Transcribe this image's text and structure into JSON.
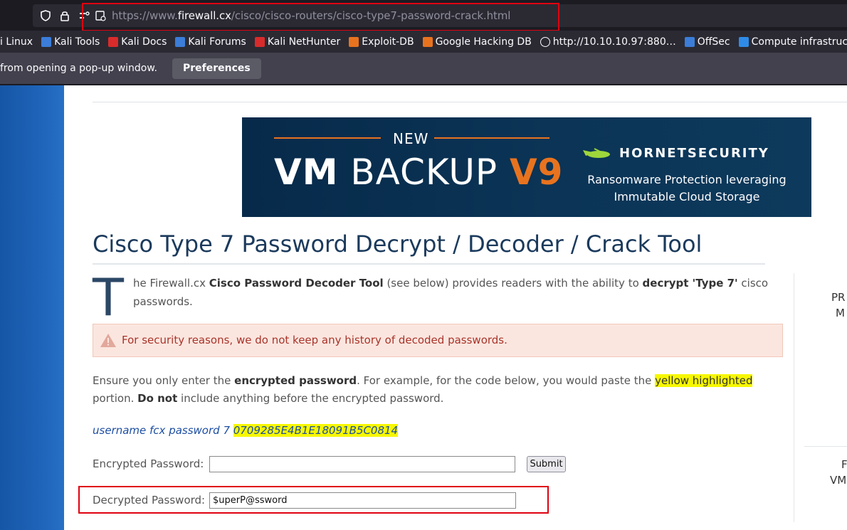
{
  "browser": {
    "url_prefix": "https://www.",
    "url_domain": "firewall.cx",
    "url_path": "/cisco/cisco-routers/cisco-type7-password-crack.html",
    "bookmarks": [
      {
        "label": "i Linux",
        "icon": "kali-icon",
        "color": "#2b2a33"
      },
      {
        "label": "Kali Tools",
        "icon": "kali-tools-icon",
        "color": "#3b7dd8"
      },
      {
        "label": "Kali Docs",
        "icon": "kali-docs-icon",
        "color": "#d92b2b"
      },
      {
        "label": "Kali Forums",
        "icon": "kali-forums-icon",
        "color": "#3b7dd8"
      },
      {
        "label": "Kali NetHunter",
        "icon": "nethunter-icon",
        "color": "#d92b2b"
      },
      {
        "label": "Exploit-DB",
        "icon": "exploit-db-icon",
        "color": "#e8731f"
      },
      {
        "label": "Google Hacking DB",
        "icon": "ghdb-icon",
        "color": "#e8731f"
      },
      {
        "label": "http://10.10.10.97:880…",
        "icon": "globe-icon",
        "color": "#2b2a33"
      },
      {
        "label": "OffSec",
        "icon": "offsec-icon",
        "color": "#3b7dd8"
      },
      {
        "label": "Compute infrastructur…",
        "icon": "azure-icon",
        "color": "#2f8be8"
      }
    ],
    "notification": {
      "text": "from opening a pop-up window.",
      "button_label": "Preferences"
    }
  },
  "banner": {
    "new_label": "NEW",
    "product_vm": "VM",
    "product_backup": " BACKUP ",
    "product_version": "V9",
    "brand": "HORNETSECURITY",
    "tagline_1": "Ransomware Protection leveraging",
    "tagline_2": "Immutable Cloud Storage",
    "colors": {
      "accent": "#e8731f",
      "background": "#0b3456"
    }
  },
  "article": {
    "title": "Cisco Type 7 Password Decrypt / Decoder / Crack Tool",
    "dropcap": "T",
    "intro": {
      "part1": "he Firewall.cx ",
      "bold1": "Cisco Password Decoder Tool",
      "part2": " (see below) provides readers with the ability to ",
      "bold2": "decrypt 'Type 7'",
      "part3": " cisco passwords."
    },
    "alert": {
      "icon": "warning-icon",
      "text": "For security reasons, we do not keep any history of decoded passwords."
    },
    "instructions": {
      "part1": "Ensure you only enter the ",
      "bold1": "encrypted password",
      "part2": ". For example, for the code below, you would paste the ",
      "highlight": "yellow highlighted",
      "part3": " portion. ",
      "bold2": "Do not",
      "part4": " include anything before the encrypted password."
    },
    "example": {
      "prefix": "username fcx password 7 ",
      "code": "0709285E4B1E18091B5C0814"
    }
  },
  "form": {
    "encrypted_label": "Encrypted Password:",
    "encrypted_value": "",
    "submit_label": "Submit",
    "decrypted_label": "Decrypted Password:",
    "decrypted_value": "$uperP@ssword"
  },
  "sidebar": {
    "frag1": "PR",
    "frag2": "M",
    "frag3": "F",
    "frag4": "VM"
  }
}
